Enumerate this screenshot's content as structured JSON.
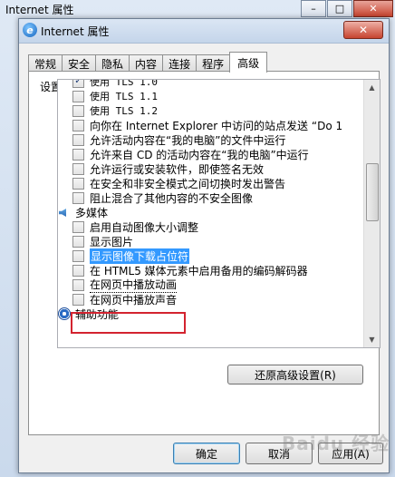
{
  "background_window": {
    "title": "Internet 属性",
    "minimize": "–",
    "maximize": "□",
    "close": "✕"
  },
  "dialog": {
    "title": "Internet 属性",
    "close": "✕",
    "tabs": [
      {
        "label": "常规",
        "active": false
      },
      {
        "label": "安全",
        "active": false
      },
      {
        "label": "隐私",
        "active": false
      },
      {
        "label": "内容",
        "active": false
      },
      {
        "label": "连接",
        "active": false
      },
      {
        "label": "程序",
        "active": false
      },
      {
        "label": "高级",
        "active": true
      }
    ],
    "settings_label": "设置",
    "items": [
      {
        "type": "opt",
        "checked": true,
        "label": "使用 TLS 1.0",
        "mono": true
      },
      {
        "type": "opt",
        "checked": false,
        "label": "使用 TLS 1.1",
        "mono": true
      },
      {
        "type": "opt",
        "checked": false,
        "label": "使用 TLS 1.2",
        "mono": true
      },
      {
        "type": "opt",
        "checked": false,
        "label": "向你在 Internet Explorer 中访问的站点发送 “Do 1"
      },
      {
        "type": "opt",
        "checked": false,
        "label": "允许活动内容在“我的电脑”的文件中运行"
      },
      {
        "type": "opt",
        "checked": false,
        "label": "允许来自 CD 的活动内容在“我的电脑”中运行"
      },
      {
        "type": "opt",
        "checked": false,
        "label": "允许运行或安装软件，即使签名无效"
      },
      {
        "type": "opt",
        "checked": false,
        "label": "在安全和非安全模式之间切换时发出警告"
      },
      {
        "type": "opt",
        "checked": false,
        "label": "阻止混合了其他内容的不安全图像"
      },
      {
        "type": "cat",
        "icon": "media",
        "label": "多媒体"
      },
      {
        "type": "opt",
        "checked": false,
        "label": "启用自动图像大小调整"
      },
      {
        "type": "opt",
        "checked": false,
        "label": "显示图片"
      },
      {
        "type": "opt",
        "checked": false,
        "label": "显示图像下载占位符",
        "selected": true
      },
      {
        "type": "opt",
        "checked": false,
        "label": "在 HTML5 媒体元素中启用备用的编码解码器"
      },
      {
        "type": "opt",
        "checked": false,
        "label": "在网页中播放动画"
      },
      {
        "type": "opt",
        "checked": false,
        "label": "在网页中播放声音"
      },
      {
        "type": "cat",
        "icon": "access",
        "label": "辅助功能"
      }
    ],
    "restore_button": "还原高级设置(R)",
    "ok_button": "确定",
    "cancel_button": "取消",
    "apply_button": "应用(A)",
    "watermark": "Baidu 经验",
    "accent_colors": {
      "selection": "#3399ff",
      "highlight_box": "#d3232f"
    }
  }
}
